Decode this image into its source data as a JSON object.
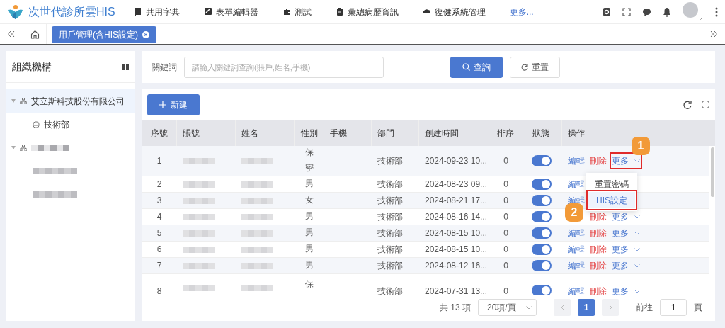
{
  "app": {
    "title": "次世代診所雲HIS"
  },
  "menu": [
    {
      "label": "共用字典"
    },
    {
      "label": "表單編輯器"
    },
    {
      "label": "測試"
    },
    {
      "label": "彙總病歷資訊"
    },
    {
      "label": "復健系統管理"
    }
  ],
  "menu_more": "更多...",
  "tabs": [
    {
      "label": "用戶管理(含HIS設定)",
      "selected": true
    }
  ],
  "sidebar": {
    "title": "組織機構",
    "tree": [
      {
        "kind": "org",
        "label": "艾立斯科技股份有限公司",
        "expanded": true,
        "selected": true,
        "children": [
          {
            "kind": "dept",
            "label": "技術部",
            "selected": false
          }
        ]
      },
      {
        "kind": "org",
        "expanded": true,
        "selected": false,
        "children": [
          {
            "kind": "plain",
            "selected": false
          },
          {
            "kind": "plain",
            "selected": false
          }
        ]
      }
    ]
  },
  "search": {
    "label": "關鍵詞",
    "placeholder": "請輸入關鍵詞查詢(賬戶,姓名,手機)",
    "buttons": [
      {
        "label": "查詢",
        "kind": "search"
      },
      {
        "label": "重置",
        "kind": "reset"
      }
    ]
  },
  "toolbar": {
    "add": "新建"
  },
  "table": {
    "columns": [
      "序號",
      "賬號",
      "姓名",
      "性別",
      "手機",
      "部門",
      "創建時間",
      "排序",
      "狀態",
      "操作"
    ],
    "rows": [
      {
        "no": "1",
        "sex": "保密",
        "dept": "技術部",
        "created": "2024-09-23 10...",
        "order": "0",
        "enabled": true,
        "actions": [
          {
            "kind": "edit",
            "label": "編輯"
          },
          {
            "kind": "delete",
            "label": "刪除"
          },
          {
            "kind": "more",
            "label": "更多",
            "outlined": true,
            "callout": "1"
          }
        ]
      },
      {
        "no": "2",
        "sex": "男",
        "dept": "技術部",
        "created": "2024-08-23 09...",
        "order": "0",
        "enabled": true,
        "actions": [
          {
            "kind": "edit",
            "label": "編輯"
          }
        ]
      },
      {
        "no": "3",
        "sex": "女",
        "dept": "技術部",
        "created": "2024-08-21 17...",
        "order": "0",
        "enabled": true,
        "actions": [
          {
            "kind": "edit",
            "label": "編輯"
          }
        ]
      },
      {
        "no": "4",
        "sex": "男",
        "dept": "技術部",
        "created": "2024-08-16 14...",
        "order": "0",
        "enabled": true,
        "actions": [
          {
            "kind": "delete",
            "label": "刪除"
          },
          {
            "kind": "more",
            "label": "更多"
          }
        ]
      },
      {
        "no": "5",
        "sex": "男",
        "dept": "技術部",
        "created": "2024-08-15 10...",
        "order": "0",
        "enabled": true,
        "actions": [
          {
            "kind": "edit",
            "label": "編輯"
          },
          {
            "kind": "delete",
            "label": "刪除"
          },
          {
            "kind": "more",
            "label": "更多"
          }
        ]
      },
      {
        "no": "6",
        "sex": "男",
        "dept": "技術部",
        "created": "2024-08-15 10...",
        "order": "0",
        "enabled": true,
        "actions": [
          {
            "kind": "edit",
            "label": "編輯"
          },
          {
            "kind": "delete",
            "label": "刪除"
          },
          {
            "kind": "more",
            "label": "更多"
          }
        ]
      },
      {
        "no": "7",
        "sex": "男",
        "dept": "技術部",
        "created": "2024-08-12 16...",
        "order": "0",
        "enabled": true,
        "actions": [
          {
            "kind": "edit",
            "label": "編輯"
          },
          {
            "kind": "delete",
            "label": "刪除"
          },
          {
            "kind": "more",
            "label": "更多"
          }
        ]
      },
      {
        "no": "8",
        "sex": "保",
        "dept": "技術部",
        "created": "2024-07-31 13...",
        "order": "0",
        "enabled": true,
        "actions": [
          {
            "kind": "edit",
            "label": "編輯"
          },
          {
            "kind": "delete",
            "label": "刪除"
          },
          {
            "kind": "more",
            "label": "更多"
          }
        ]
      }
    ]
  },
  "dropdown": {
    "items": [
      {
        "label": "重置密碼",
        "highlighted": false
      },
      {
        "label": "HIS設定",
        "highlighted": true,
        "outlined": true,
        "callout": "2"
      }
    ]
  },
  "pagination": {
    "total": "共 13 項",
    "page_size": "20項/頁",
    "pages": [
      {
        "label": "1",
        "selected": true
      }
    ],
    "goto_label": "前往",
    "goto_value": "1",
    "suffix": "頁"
  }
}
